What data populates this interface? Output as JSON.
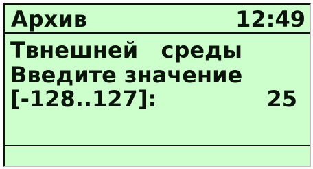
{
  "colors": {
    "screen_background": "#ccffcc",
    "text": "#0a140a"
  },
  "header": {
    "title": "Архив",
    "clock": "12:49"
  },
  "content": {
    "line1": "Твнешней   среды",
    "line2": "Введите значение",
    "range": "[-128..127]:",
    "value": "25"
  }
}
